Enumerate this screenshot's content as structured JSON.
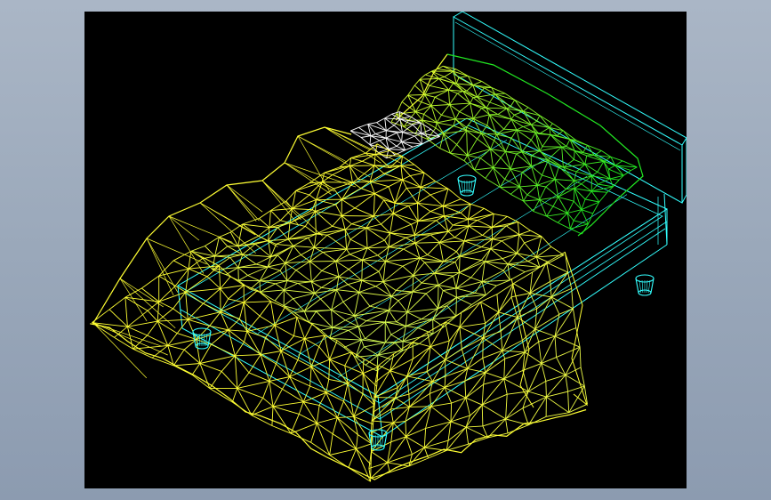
{
  "canvas": {
    "background": "#000000",
    "frame_background": "#9aa8ba"
  },
  "model": {
    "subject": "bed-wireframe",
    "colors": {
      "blanket": "#ffff33",
      "pillow_gradient_start": "#f2ff30",
      "pillow_gradient_end": "#22e822",
      "frame": "#33ffff",
      "sheet_corner": "#ffffff"
    }
  }
}
